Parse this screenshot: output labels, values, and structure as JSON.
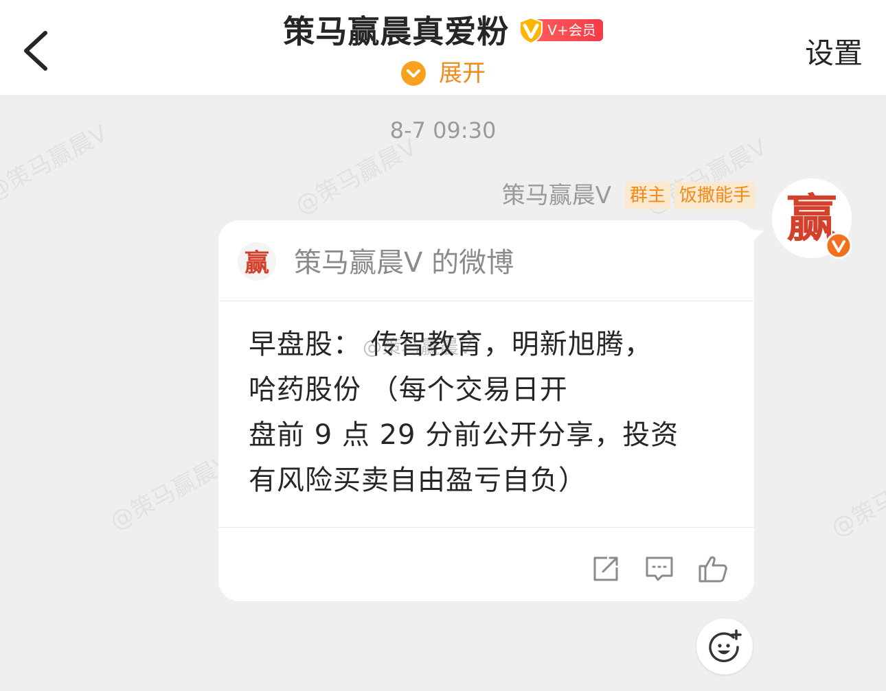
{
  "header": {
    "title": "策马赢晨真爱粉",
    "vip_label": "V+会员",
    "expand_label": "展开",
    "settings_label": "设置"
  },
  "watermark": "@策马赢晨V",
  "message": {
    "timestamp": "8-7 09:30",
    "sender_name": "策马赢晨Ⅴ",
    "tags": [
      "群主",
      "饭撒能手"
    ],
    "avatar_glyph": "赢",
    "card": {
      "source": "策马赢晨Ⅴ 的微博",
      "lines": [
        "早盘股：  传智教育，明新旭腾，",
        "哈药股份           （每个交易日开",
        "盘前 9 点 29 分前公开分享，投资",
        "有风险买卖自由盈亏自负）"
      ]
    }
  },
  "icons": {
    "back": "chevron-left-icon",
    "vip": "vip-shield-icon",
    "expand": "chevron-down-circle-icon",
    "verified": "verified-v-icon",
    "share": "share-icon",
    "comment": "comment-icon",
    "like": "thumbs-up-icon",
    "emoji": "emoji-add-icon"
  },
  "colors": {
    "accent_orange": "#f08a1a",
    "vip_red": "#f23b48",
    "avatar_red": "#d3412b",
    "background": "#efefef"
  }
}
